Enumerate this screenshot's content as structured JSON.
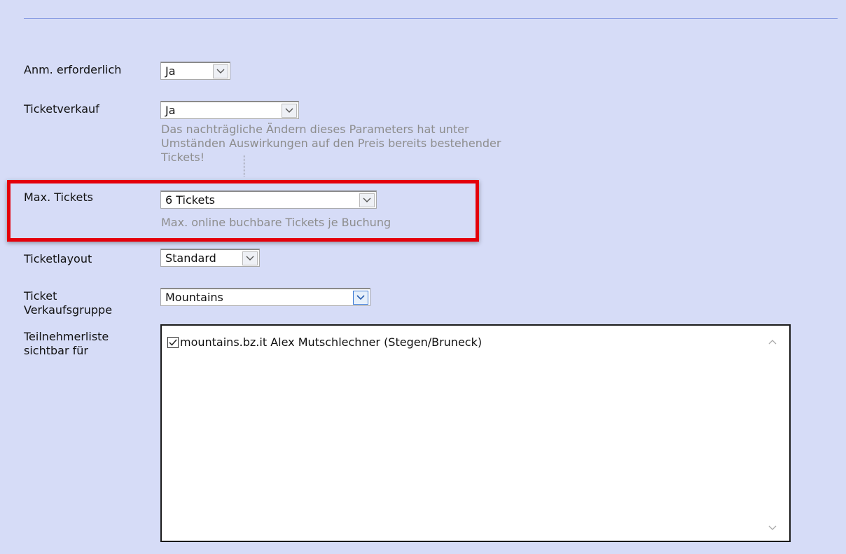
{
  "form": {
    "registration": {
      "label": "Anm. erforderlich",
      "value": "Ja"
    },
    "ticket_sale": {
      "label": "Ticketverkauf",
      "value": "Ja",
      "hint": [
        "Das nachträgliche Ändern dieses Parameters hat unter",
        "Umständen Auswirkungen auf den Preis bereits bestehender",
        "Tickets!"
      ]
    },
    "max_tickets": {
      "label": "Max. Tickets",
      "value": "6 Tickets",
      "hint": "Max. online buchbare Tickets je Buchung"
    },
    "ticket_layout": {
      "label": "Ticketlayout",
      "value": "Standard"
    },
    "sales_group": {
      "label_line1": "Ticket",
      "label_line2": "Verkaufsgruppe",
      "value": "Mountains"
    },
    "participants": {
      "label_line1": "Teilnehmerliste",
      "label_line2": "sichtbar für",
      "items": [
        {
          "label": "mountains.bz.it Alex Mutschlechner (Stegen/Bruneck)",
          "checked": true
        }
      ]
    }
  },
  "icons": {
    "dropdown": "chevron-down-icon",
    "checkbox": "checkmark-icon",
    "scroll_up": "chevron-up-icon",
    "scroll_down": "chevron-down-icon"
  },
  "colors": {
    "page_background": "#d6dcf7",
    "highlight_border": "#e4000b",
    "hint_text": "#8d8d8d",
    "active_arrow_border": "#3d7bd6"
  }
}
